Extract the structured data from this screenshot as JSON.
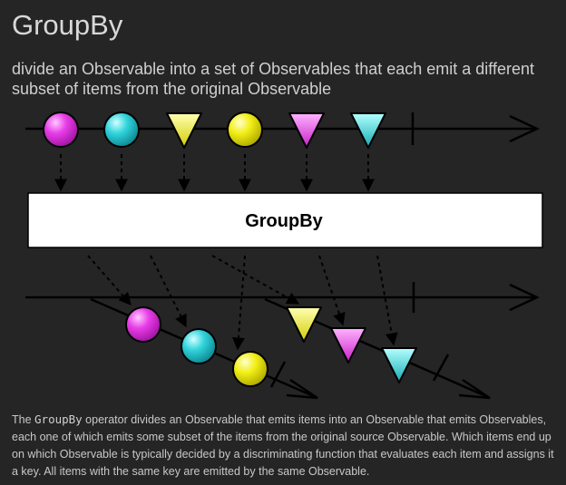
{
  "header": {
    "title": "GroupBy",
    "subtitle": "divide an Observable into a set of Observables that each emit a different subset of items from the original Observable"
  },
  "diagram": {
    "operator_label": "GroupBy",
    "colors": {
      "magenta": "#e83de8",
      "cyan": "#31d4dc",
      "yellow": "#f2ef16",
      "line": "#000000",
      "box": "#ffffff"
    },
    "source_items": [
      {
        "shape": "circle",
        "color": "magenta"
      },
      {
        "shape": "circle",
        "color": "cyan"
      },
      {
        "shape": "triangle",
        "color": "yellow"
      },
      {
        "shape": "circle",
        "color": "yellow"
      },
      {
        "shape": "triangle",
        "color": "magenta"
      },
      {
        "shape": "triangle",
        "color": "cyan"
      }
    ],
    "circle_group": [
      {
        "shape": "circle",
        "color": "magenta"
      },
      {
        "shape": "circle",
        "color": "cyan"
      },
      {
        "shape": "circle",
        "color": "yellow"
      }
    ],
    "triangle_group": [
      {
        "shape": "triangle",
        "color": "yellow"
      },
      {
        "shape": "triangle",
        "color": "magenta"
      },
      {
        "shape": "triangle",
        "color": "cyan"
      }
    ]
  },
  "description": {
    "before_code": "The ",
    "code": "GroupBy",
    "after_code": " operator divides an Observable that emits items into an Observable that emits Observables, each one of which emits some subset of the items from the original source Observable. Which items end up on which Observable is typically decided by a discriminating function that evaluates each item and assigns it a key. All items with the same key are emitted by the same Observable."
  }
}
